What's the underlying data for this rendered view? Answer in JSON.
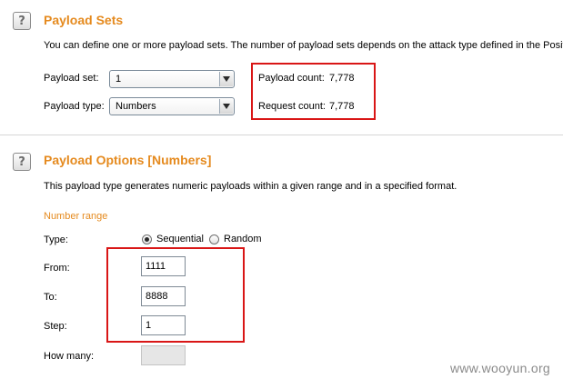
{
  "payload_sets": {
    "title": "Payload Sets",
    "description": "You can define one or more payload sets. The number of payload sets depends on the attack type defined in the Positi",
    "set_label": "Payload set:",
    "set_value": "1",
    "type_label": "Payload type:",
    "type_value": "Numbers",
    "payload_count_label": "Payload count:",
    "payload_count_value": "7,778",
    "request_count_label": "Request count:",
    "request_count_value": "7,778"
  },
  "payload_options": {
    "title": "Payload Options [Numbers]",
    "description": "This payload type generates numeric payloads within a given range and in a specified format.",
    "number_range_label": "Number range",
    "type_label": "Type:",
    "sequential_label": "Sequential",
    "random_label": "Random",
    "selected_type": "Sequential",
    "from_label": "From:",
    "from_value": "1111",
    "to_label": "To:",
    "to_value": "8888",
    "step_label": "Step:",
    "step_value": "1",
    "how_many_label": "How many:",
    "how_many_value": ""
  },
  "help_icon_glyph": "?",
  "watermark": "www.wooyun.org",
  "colors": {
    "section_title": "#e58a1e",
    "highlight_box": "#d91616"
  }
}
